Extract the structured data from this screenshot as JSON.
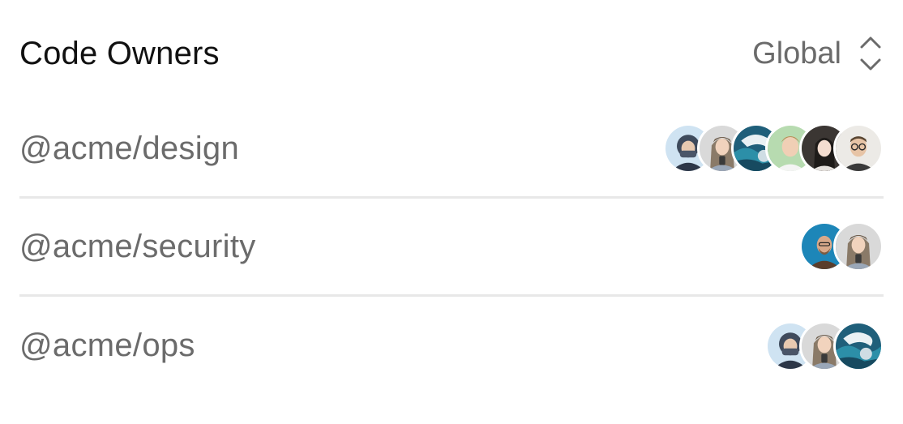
{
  "header": {
    "title": "Code Owners",
    "scope": {
      "selected": "Global",
      "icon": "chevron-up-down-icon"
    }
  },
  "owners": [
    {
      "team": "@acme/design",
      "avatars": [
        "winter-hood",
        "woman-cap",
        "ocean-blue",
        "man-green",
        "woman-dark",
        "man-glasses"
      ]
    },
    {
      "team": "@acme/security",
      "avatars": [
        "man-blue-bg",
        "woman-cap"
      ]
    },
    {
      "team": "@acme/ops",
      "avatars": [
        "winter-hood",
        "woman-cap",
        "ocean-blue"
      ]
    }
  ],
  "colors": {
    "title": "#111111",
    "muted_text": "#6b6b6b",
    "divider": "#e8e8e8",
    "background": "#ffffff"
  }
}
